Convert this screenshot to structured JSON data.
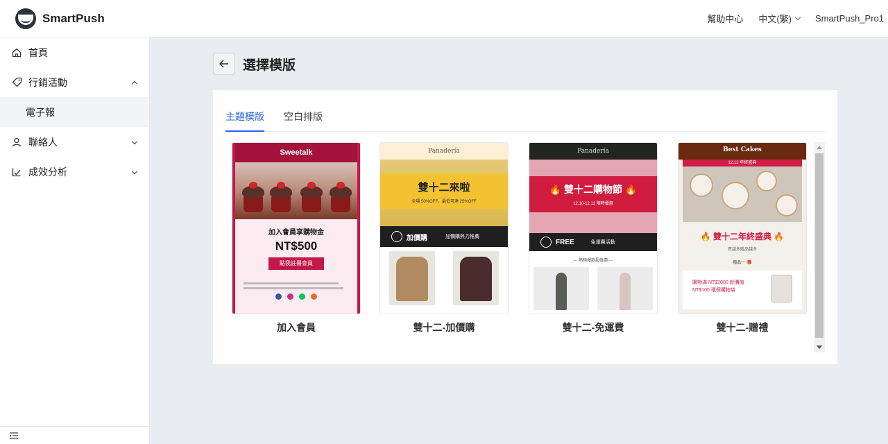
{
  "header": {
    "brand": "SmartPush",
    "help": "幫助中心",
    "language": "中文(繁)",
    "account": "SmartPush_Pro1"
  },
  "sidebar": {
    "items": [
      {
        "label": "首頁",
        "icon": "home-icon"
      },
      {
        "label": "行銷活動",
        "icon": "tag-icon",
        "expanded": true
      },
      {
        "label": "電子報",
        "sub": true
      },
      {
        "label": "聯絡人",
        "icon": "user-icon"
      },
      {
        "label": "成效分析",
        "icon": "chart-check-icon"
      }
    ]
  },
  "page": {
    "title": "選擇模版",
    "tabs": [
      {
        "label": "主題模版",
        "active": true
      },
      {
        "label": "空白排版",
        "active": false
      }
    ],
    "templates": [
      {
        "name": "加入會員",
        "art": {
          "brand": "Sweetalk",
          "headline": "加入會員享購物金",
          "amount": "NT$500",
          "button": "點我註冊會員"
        }
      },
      {
        "name": "雙十二-加價購",
        "art": {
          "brand": "Panadería",
          "headline": "雙十二來啦",
          "subline": "全場 50%OFF，最低可達 25%OFF",
          "strip": "加價購",
          "strip_side": "加價購熱力推薦"
        }
      },
      {
        "name": "雙十二-免運費",
        "art": {
          "brand": "Panadería",
          "headline": "🔥 雙十二購物節 🔥",
          "subline": "12.10-12.12 限時優惠",
          "strip": "FREE",
          "strip_side": "免運費活動",
          "section": "--- 熱銷爆款超值價 ---"
        }
      },
      {
        "name": "雙十二-贈禮",
        "art": {
          "brand": "Best Cakes",
          "bar": "12.12 年終盛典",
          "headline": "🔥 雙十二年終盛典 🔥",
          "subline": "買越多贈品越多",
          "gift": "贈品一 🎁",
          "box_text": "購物滿 NT$2000 就價值 NT$100 環保購物袋"
        }
      }
    ]
  },
  "colors": {
    "accent": "#2563eb",
    "sweetalk_red": "#c2184a",
    "panaderia_yellow": "#f2c230",
    "panaderia_red": "#d01c3f"
  }
}
